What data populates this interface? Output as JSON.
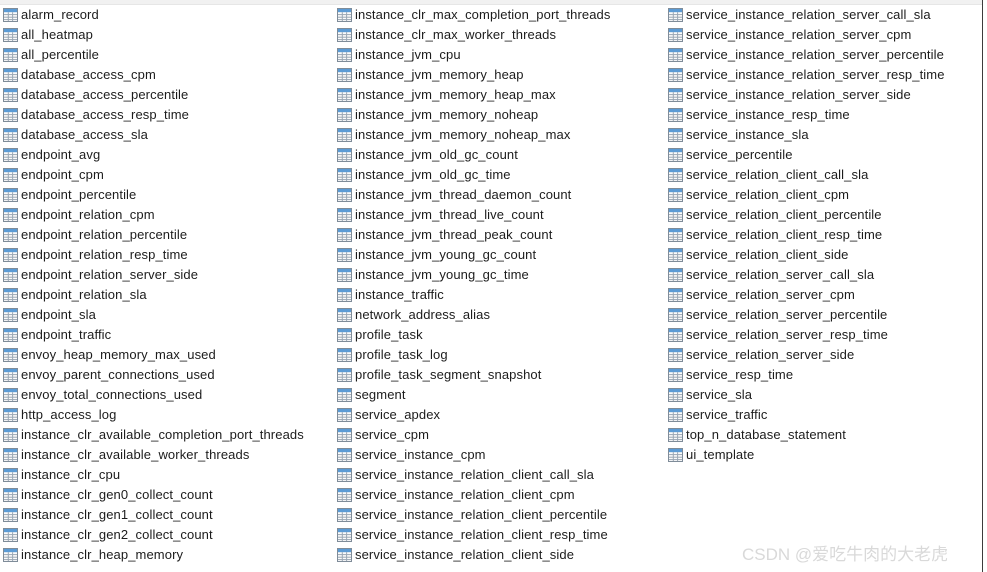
{
  "window": {
    "kind": "database-table-list-pane",
    "background_color": "#ffffff",
    "border_color": "#3c3c3c",
    "top_strip_color": "#f1f1f1"
  },
  "icon": {
    "semantic_name": "table-icon",
    "header_color": "#5b9bd5",
    "grid_line_color": "#9aa7b4",
    "body_color": "#fbfbfb",
    "border_color": "#7f8c99"
  },
  "watermark": {
    "text": "CSDN @爱吃牛肉的大老虎",
    "color": "#d9d9d9"
  },
  "columns": [
    {
      "name": "column-1",
      "items": [
        "alarm_record",
        "all_heatmap",
        "all_percentile",
        "database_access_cpm",
        "database_access_percentile",
        "database_access_resp_time",
        "database_access_sla",
        "endpoint_avg",
        "endpoint_cpm",
        "endpoint_percentile",
        "endpoint_relation_cpm",
        "endpoint_relation_percentile",
        "endpoint_relation_resp_time",
        "endpoint_relation_server_side",
        "endpoint_relation_sla",
        "endpoint_sla",
        "endpoint_traffic",
        "envoy_heap_memory_max_used",
        "envoy_parent_connections_used",
        "envoy_total_connections_used",
        "http_access_log",
        "instance_clr_available_completion_port_threads",
        "instance_clr_available_worker_threads",
        "instance_clr_cpu",
        "instance_clr_gen0_collect_count",
        "instance_clr_gen1_collect_count",
        "instance_clr_gen2_collect_count",
        "instance_clr_heap_memory"
      ]
    },
    {
      "name": "column-2",
      "items": [
        "instance_clr_max_completion_port_threads",
        "instance_clr_max_worker_threads",
        "instance_jvm_cpu",
        "instance_jvm_memory_heap",
        "instance_jvm_memory_heap_max",
        "instance_jvm_memory_noheap",
        "instance_jvm_memory_noheap_max",
        "instance_jvm_old_gc_count",
        "instance_jvm_old_gc_time",
        "instance_jvm_thread_daemon_count",
        "instance_jvm_thread_live_count",
        "instance_jvm_thread_peak_count",
        "instance_jvm_young_gc_count",
        "instance_jvm_young_gc_time",
        "instance_traffic",
        "network_address_alias",
        "profile_task",
        "profile_task_log",
        "profile_task_segment_snapshot",
        "segment",
        "service_apdex",
        "service_cpm",
        "service_instance_cpm",
        "service_instance_relation_client_call_sla",
        "service_instance_relation_client_cpm",
        "service_instance_relation_client_percentile",
        "service_instance_relation_client_resp_time",
        "service_instance_relation_client_side"
      ]
    },
    {
      "name": "column-3",
      "items": [
        "service_instance_relation_server_call_sla",
        "service_instance_relation_server_cpm",
        "service_instance_relation_server_percentile",
        "service_instance_relation_server_resp_time",
        "service_instance_relation_server_side",
        "service_instance_resp_time",
        "service_instance_sla",
        "service_percentile",
        "service_relation_client_call_sla",
        "service_relation_client_cpm",
        "service_relation_client_percentile",
        "service_relation_client_resp_time",
        "service_relation_client_side",
        "service_relation_server_call_sla",
        "service_relation_server_cpm",
        "service_relation_server_percentile",
        "service_relation_server_resp_time",
        "service_relation_server_side",
        "service_resp_time",
        "service_sla",
        "service_traffic",
        "top_n_database_statement",
        "ui_template"
      ]
    }
  ]
}
